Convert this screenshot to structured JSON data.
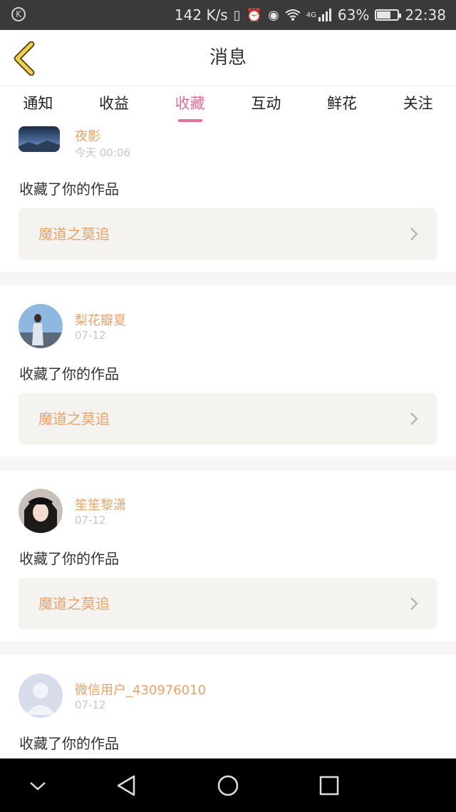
{
  "status_bar": {
    "speed": "142 K/s",
    "network": "4G",
    "battery_percent": "63%",
    "battery_level": 0.63,
    "time": "22:38"
  },
  "header": {
    "title": "消息"
  },
  "tabs": [
    {
      "label": "通知",
      "active": false
    },
    {
      "label": "收益",
      "active": false
    },
    {
      "label": "收藏",
      "active": true
    },
    {
      "label": "互动",
      "active": false
    },
    {
      "label": "鲜花",
      "active": false
    },
    {
      "label": "关注",
      "active": false
    }
  ],
  "messages": [
    {
      "user": "夜影",
      "time": "今天 00:06",
      "action": "收藏了你的作品",
      "work": "魔道之莫追"
    },
    {
      "user": "梨花瓣夏",
      "time": "07-12",
      "action": "收藏了你的作品",
      "work": "魔道之莫追"
    },
    {
      "user": "笙笙黎潇",
      "time": "07-12",
      "action": "收藏了你的作品",
      "work": "魔道之莫追"
    },
    {
      "user": "微信用户_430976010",
      "time": "07-12",
      "action": "收藏了你的作品",
      "work": ""
    }
  ],
  "colors": {
    "accent_pink": "#e2709a",
    "username_orange": "#e7a36c",
    "work_box_bg": "#f4f3ef",
    "status_bar_bg": "#3a3a3a"
  }
}
